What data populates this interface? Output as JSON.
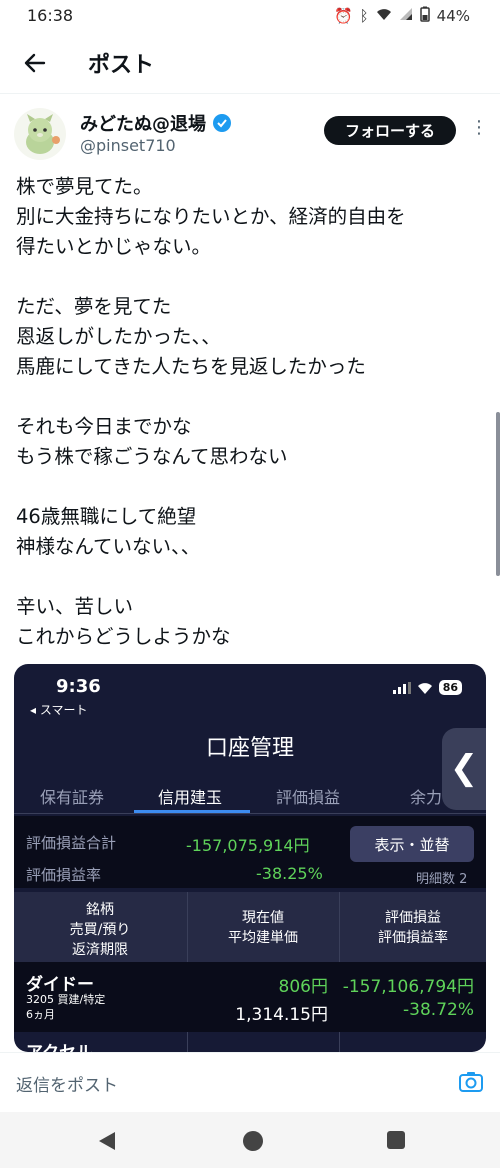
{
  "status_bar": {
    "time": "16:38",
    "battery": "44%"
  },
  "header": {
    "title": "ポスト"
  },
  "author": {
    "name": "みどたぬ@退場",
    "handle": "@pinset710",
    "follow_label": "フォローする"
  },
  "tweet": {
    "lines": [
      "株で夢見てた。",
      "別に大金持ちになりたいとか、経済的自由を",
      "得たいとかじゃない。",
      "",
      "ただ、夢を見てた",
      "恩返しがしたかった、、",
      "馬鹿にしてきた人たちを見返したかった",
      "",
      "それも今日までかな",
      "もう株で稼ごうなんて思わない",
      "",
      "46歳無職にして絶望",
      "神様なんていない、、",
      "",
      "辛い、苦しい",
      "これからどうしようかな"
    ]
  },
  "media": {
    "time": "9:36",
    "battery": "86",
    "back_label": "◂ スマート",
    "title": "口座管理",
    "tabs": [
      "保有証券",
      "信用建玉",
      "評価損益",
      "余力"
    ],
    "summary": {
      "total_label": "評価損益合計",
      "total_value": "-157,075,914円",
      "rate_label": "評価損益率",
      "rate_value": "-38.25%",
      "button": "表示・並替",
      "count": "明細数 2"
    },
    "columns": [
      [
        "銘柄",
        "売買/預り",
        "返済期限"
      ],
      [
        "現在値",
        "平均建単価"
      ],
      [
        "評価損益",
        "評価損益率"
      ]
    ],
    "row": {
      "name": "ダイドー",
      "sub1": "3205 買建/特定",
      "sub2": "6ヵ月",
      "price": "806円",
      "avg": "1,314.15円",
      "pl": "-157,106,794円",
      "pl_rate": "-38.72%"
    },
    "next_row_name": "アクセル"
  },
  "reply": {
    "placeholder": "返信をポスト"
  },
  "colors": {
    "accent": "#1d9bf0",
    "green": "#5fd35a",
    "red": "#ff4d6a",
    "dark_bg": "#161a35"
  }
}
